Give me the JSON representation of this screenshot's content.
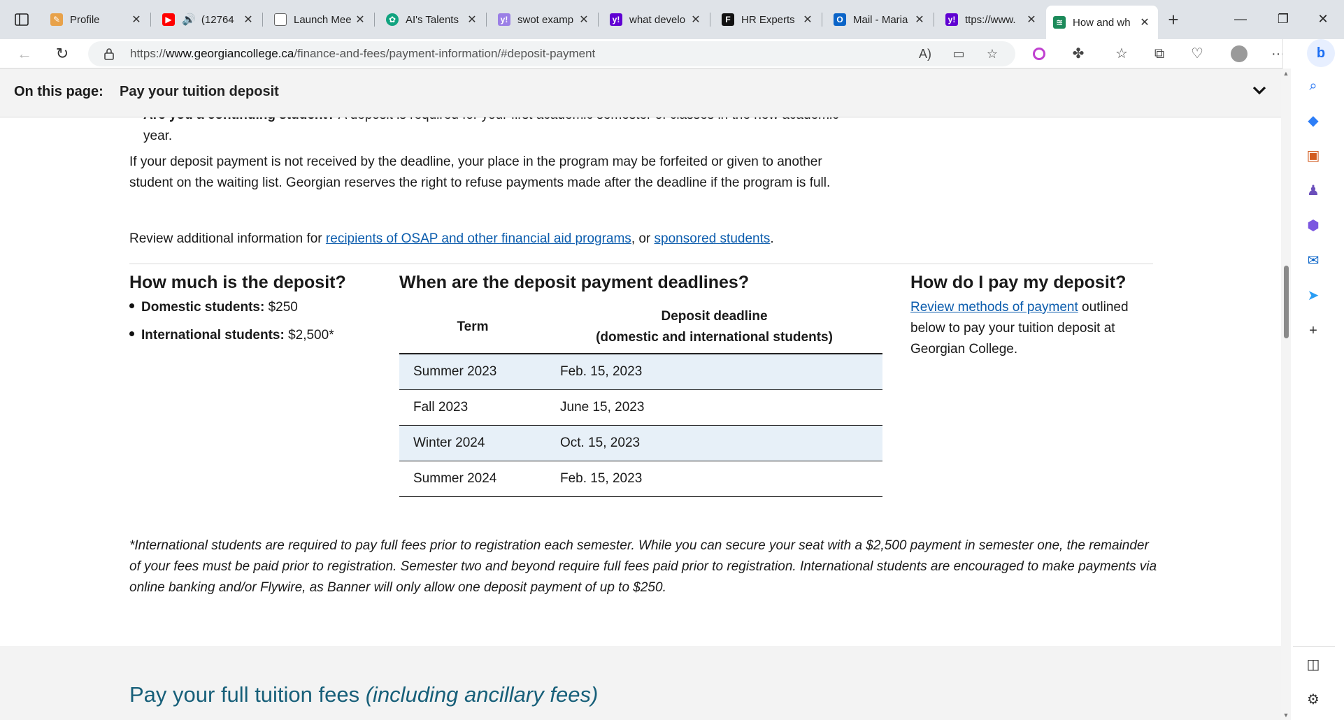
{
  "browser": {
    "tabs": [
      {
        "title": "Profile",
        "favicon": "profile-page-icon",
        "color": "#e8a24a"
      },
      {
        "title": "(12764",
        "favicon": "youtube-icon",
        "color": "#ff0000",
        "audio": true
      },
      {
        "title": "Launch Mee",
        "favicon": "document-icon",
        "color": "#666666"
      },
      {
        "title": "AI's Talents",
        "favicon": "openai-icon",
        "color": "#10a37f"
      },
      {
        "title": "swot examp",
        "favicon": "yahoo-icon",
        "color": "#7b5cd6"
      },
      {
        "title": "what develo",
        "favicon": "yahoo-icon",
        "color": "#6001d2"
      },
      {
        "title": "HR Experts",
        "favicon": "forbes-icon",
        "color": "#111111"
      },
      {
        "title": "Mail - Maria",
        "favicon": "outlook-icon",
        "color": "#0a64c8"
      },
      {
        "title": "ttps://www.",
        "favicon": "yahoo-icon",
        "color": "#6001d2"
      },
      {
        "title": "How and wh",
        "favicon": "georgian-icon",
        "color": "#1c8a5a",
        "active": true
      }
    ],
    "address": {
      "prefix": "https://",
      "domain": "www.georgiancollege.ca",
      "path": "/finance-and-fees/payment-information/#deposit-payment"
    }
  },
  "page": {
    "sticky": {
      "label": "On this page:",
      "value": "Pay your tuition deposit"
    },
    "partial_item": {
      "bold": "Are you a continuing student?",
      "text": " A deposit is required for your first academic semester of classes in the new academic year."
    },
    "forfeit_text": "If your deposit payment is not received by the deadline, your place in the program may be forfeited or given to another student on the waiting list. Georgian reserves the right to refuse payments made after the deadline if the program is full.",
    "review": {
      "prefix": "Review additional information for ",
      "link1": "recipients of OSAP and other financial aid programs",
      "mid": ", or ",
      "link2": "sponsored students",
      "suffix": "."
    },
    "deposit": {
      "heading": "How much is the deposit?",
      "items": [
        {
          "label": "Domestic students:",
          "value": " $250"
        },
        {
          "label": "International students:",
          "value": " $2,500*"
        }
      ]
    },
    "deadlines": {
      "heading": "When are the deposit payment deadlines?",
      "col_term": "Term",
      "col_deadline_1": "Deposit deadline",
      "col_deadline_2": "(domestic and international students)",
      "rows": [
        {
          "term": "Summer 2023",
          "deadline": "Feb. 15, 2023"
        },
        {
          "term": "Fall 2023",
          "deadline": "June 15, 2023"
        },
        {
          "term": "Winter 2024",
          "deadline": "Oct. 15, 2023"
        },
        {
          "term": "Summer 2024",
          "deadline": "Feb. 15, 2023"
        }
      ]
    },
    "howpay": {
      "heading": "How do I pay my deposit?",
      "link": "Review methods of payment",
      "text": " outlined below to pay your tuition deposit at Georgian College."
    },
    "footnote": "*International students are required to pay full fees prior to registration each semester. While you can secure your seat with a $2,500 payment in semester one, the remainder of your fees must be paid prior to registration. Semester two and beyond require full fees paid prior to registration. International students are encouraged to make payments via online banking and/or Flywire, as Banner will only allow one deposit payment of up to $250.",
    "next_section": {
      "title": "Pay your full tuition fees ",
      "title_em": "(including ancillary fees)"
    }
  }
}
